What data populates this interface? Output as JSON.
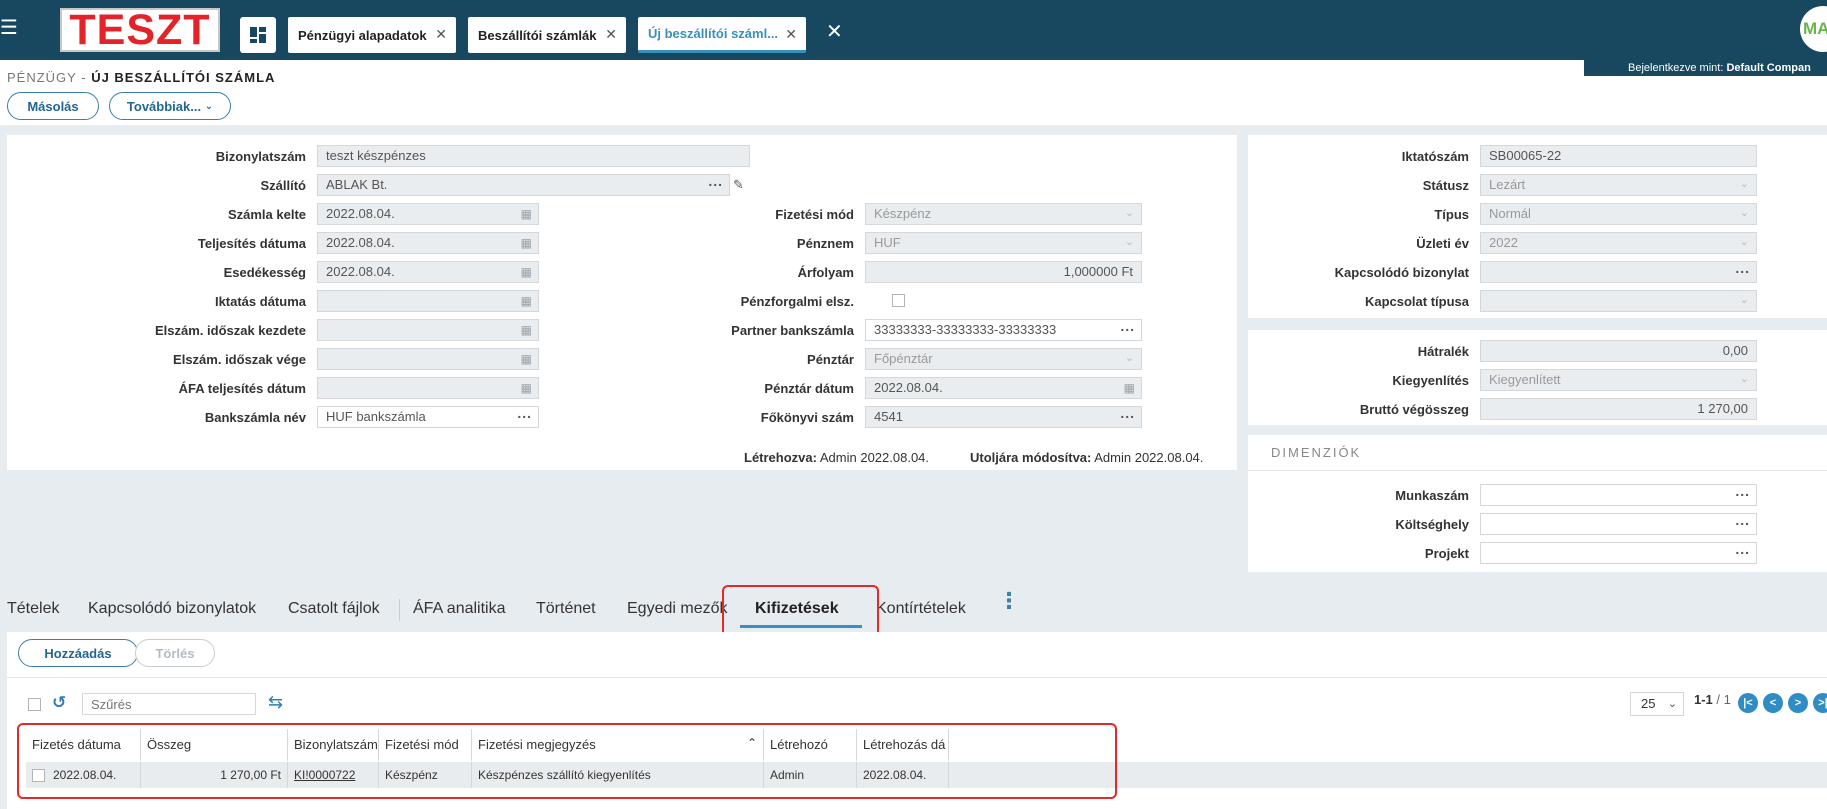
{
  "topbar": {
    "logo": "TESZT",
    "tabs": [
      {
        "label": "Pénzügyi alapadatok"
      },
      {
        "label": "Beszállítói számlák"
      },
      {
        "label": "Új beszállítói száml..."
      }
    ],
    "avatar_text": "MA",
    "user_prefix": "Bejelentkezve mint:",
    "user_name": "Default Compan"
  },
  "breadcrumb": {
    "parent": "PÉNZÜGY -",
    "current": "ÚJ BESZÁLLÍTÓI SZÁMLA"
  },
  "actions": {
    "copy": "Másolás",
    "more": "Továbbiak..."
  },
  "form_left": {
    "bizonylatszam": {
      "label": "Bizonylatszám",
      "value": "teszt készpénzes"
    },
    "szallito": {
      "label": "Szállító",
      "value": "ABLAK Bt."
    },
    "szamla_kelte": {
      "label": "Számla kelte",
      "value": "2022.08.04."
    },
    "teljesites": {
      "label": "Teljesítés dátuma",
      "value": "2022.08.04."
    },
    "esedekesseg": {
      "label": "Esedékesség",
      "value": "2022.08.04."
    },
    "iktatas": {
      "label": "Iktatás dátuma",
      "value": ""
    },
    "elszam_kezdete": {
      "label": "Elszám. időszak kezdete",
      "value": ""
    },
    "elszam_vege": {
      "label": "Elszám. időszak vége",
      "value": ""
    },
    "afa_teljesites": {
      "label": "ÁFA teljesítés dátum",
      "value": ""
    },
    "bankszamla_nev": {
      "label": "Bankszámla név",
      "value": "HUF bankszámla"
    }
  },
  "form_mid": {
    "fizetesi_mod": {
      "label": "Fizetési mód",
      "value": "Készpénz"
    },
    "penznem": {
      "label": "Pénznem",
      "value": "HUF"
    },
    "arfolyam": {
      "label": "Árfolyam",
      "value": "1,000000 Ft"
    },
    "penzforgalmi": {
      "label": "Pénzforgalmi elsz.",
      "checked": false
    },
    "partner_bank": {
      "label": "Partner bankszámla",
      "value": "33333333-33333333-33333333"
    },
    "penztar": {
      "label": "Pénztár",
      "value": "Főpénztár"
    },
    "penztar_datum": {
      "label": "Pénztár dátum",
      "value": "2022.08.04."
    },
    "fokonyvi": {
      "label": "Főkönyvi szám",
      "value": "4541"
    }
  },
  "meta": {
    "created_label": "Létrehozva:",
    "created_value": "Admin 2022.08.04.",
    "modified_label": "Utoljára módosítva:",
    "modified_value": "Admin 2022.08.04."
  },
  "form_right": {
    "iktatoszam": {
      "label": "Iktatószám",
      "value": "SB00065-22"
    },
    "statusz": {
      "label": "Státusz",
      "value": "Lezárt"
    },
    "tipus": {
      "label": "Típus",
      "value": "Normál"
    },
    "uzleti_ev": {
      "label": "Üzleti év",
      "value": "2022"
    },
    "kapcs_bizonylat": {
      "label": "Kapcsolódó bizonylat",
      "value": ""
    },
    "kapcs_tipus": {
      "label": "Kapcsolat típusa",
      "value": ""
    }
  },
  "summary": {
    "hatralek": {
      "label": "Hátralék",
      "value": "0,00"
    },
    "kiegyenlites": {
      "label": "Kiegyenlítés",
      "value": "Kiegyenlített"
    },
    "brutto": {
      "label": "Bruttó végösszeg",
      "value": "1 270,00"
    }
  },
  "dimensions": {
    "title": "DIMENZIÓK",
    "munkaszam": {
      "label": "Munkaszám",
      "value": ""
    },
    "koltseghely": {
      "label": "Költséghely",
      "value": ""
    },
    "projekt": {
      "label": "Projekt",
      "value": ""
    }
  },
  "detail_tabs": [
    {
      "label": "Tételek"
    },
    {
      "label": "Kapcsolódó bizonylatok"
    },
    {
      "label": "Csatolt fájlok"
    },
    {
      "label": "ÁFA analitika"
    },
    {
      "label": "Történet"
    },
    {
      "label": "Egyedi mezők"
    },
    {
      "label": "Kifizetések"
    },
    {
      "label": "Kontírtételek"
    }
  ],
  "grid": {
    "add": "Hozzáadás",
    "delete": "Törlés",
    "filter_placeholder": "Szűrés",
    "page_size": "25",
    "page_info": "1-1",
    "page_total": "/ 1",
    "columns": [
      "Fizetés dátuma",
      "Összeg",
      "Bizonylatszám",
      "Fizetési mód",
      "Fizetési megjegyzés",
      "Létrehozó",
      "Létrehozás dá"
    ],
    "rows": [
      {
        "date": "2022.08.04.",
        "amount": "1 270,00 Ft",
        "doc": "KI!0000722",
        "mode": "Készpénz",
        "note": "Készpénzes szállító kiegyenlítés",
        "creator": "Admin",
        "created": "2022.08.04."
      }
    ]
  }
}
